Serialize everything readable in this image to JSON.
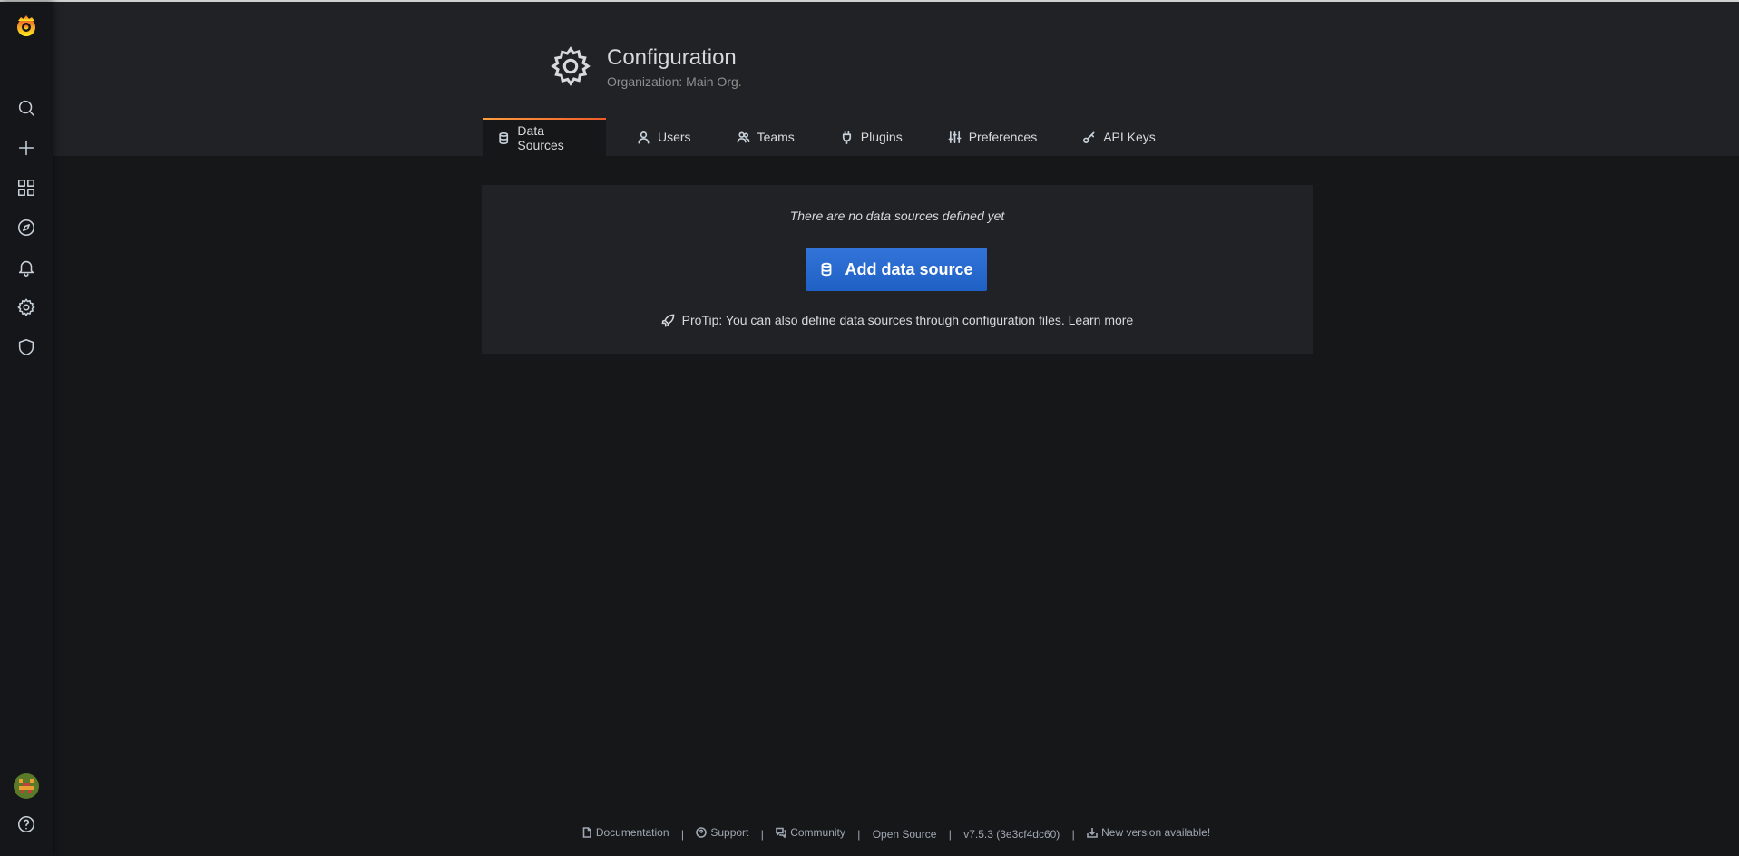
{
  "sidebar": {
    "items": [
      {
        "icon": "search-icon",
        "label": "Search"
      },
      {
        "icon": "plus-icon",
        "label": "Create"
      },
      {
        "icon": "dashboards-icon",
        "label": "Dashboards"
      },
      {
        "icon": "explore-icon",
        "label": "Explore"
      },
      {
        "icon": "bell-icon",
        "label": "Alerting"
      },
      {
        "icon": "gear-icon",
        "label": "Configuration"
      },
      {
        "icon": "shield-icon",
        "label": "Server Admin"
      }
    ],
    "bottom": [
      {
        "icon": "avatar",
        "label": "Profile"
      },
      {
        "icon": "help-icon",
        "label": "Help"
      }
    ]
  },
  "header": {
    "title": "Configuration",
    "subtitle": "Organization: Main Org."
  },
  "tabs": [
    {
      "label": "Data Sources",
      "icon": "database-icon",
      "active": true
    },
    {
      "label": "Users",
      "icon": "user-icon",
      "active": false
    },
    {
      "label": "Teams",
      "icon": "users-icon",
      "active": false
    },
    {
      "label": "Plugins",
      "icon": "plug-icon",
      "active": false
    },
    {
      "label": "Preferences",
      "icon": "sliders-icon",
      "active": false
    },
    {
      "label": "API Keys",
      "icon": "key-icon",
      "active": false
    }
  ],
  "empty_state": {
    "message": "There are no data sources defined yet",
    "button_label": "Add data source",
    "protip": "ProTip: You can also define data sources through configuration files.",
    "learn_more": "Learn more"
  },
  "footer": {
    "documentation": "Documentation",
    "support": "Support",
    "community": "Community",
    "open_source": "Open Source",
    "version": "v7.5.3 (3e3cf4dc60)",
    "new_version": "New version available!"
  },
  "colors": {
    "accent_blue": "#3274d9",
    "tab_accent": "#f05a28",
    "background": "#161719",
    "panel": "#212226"
  }
}
